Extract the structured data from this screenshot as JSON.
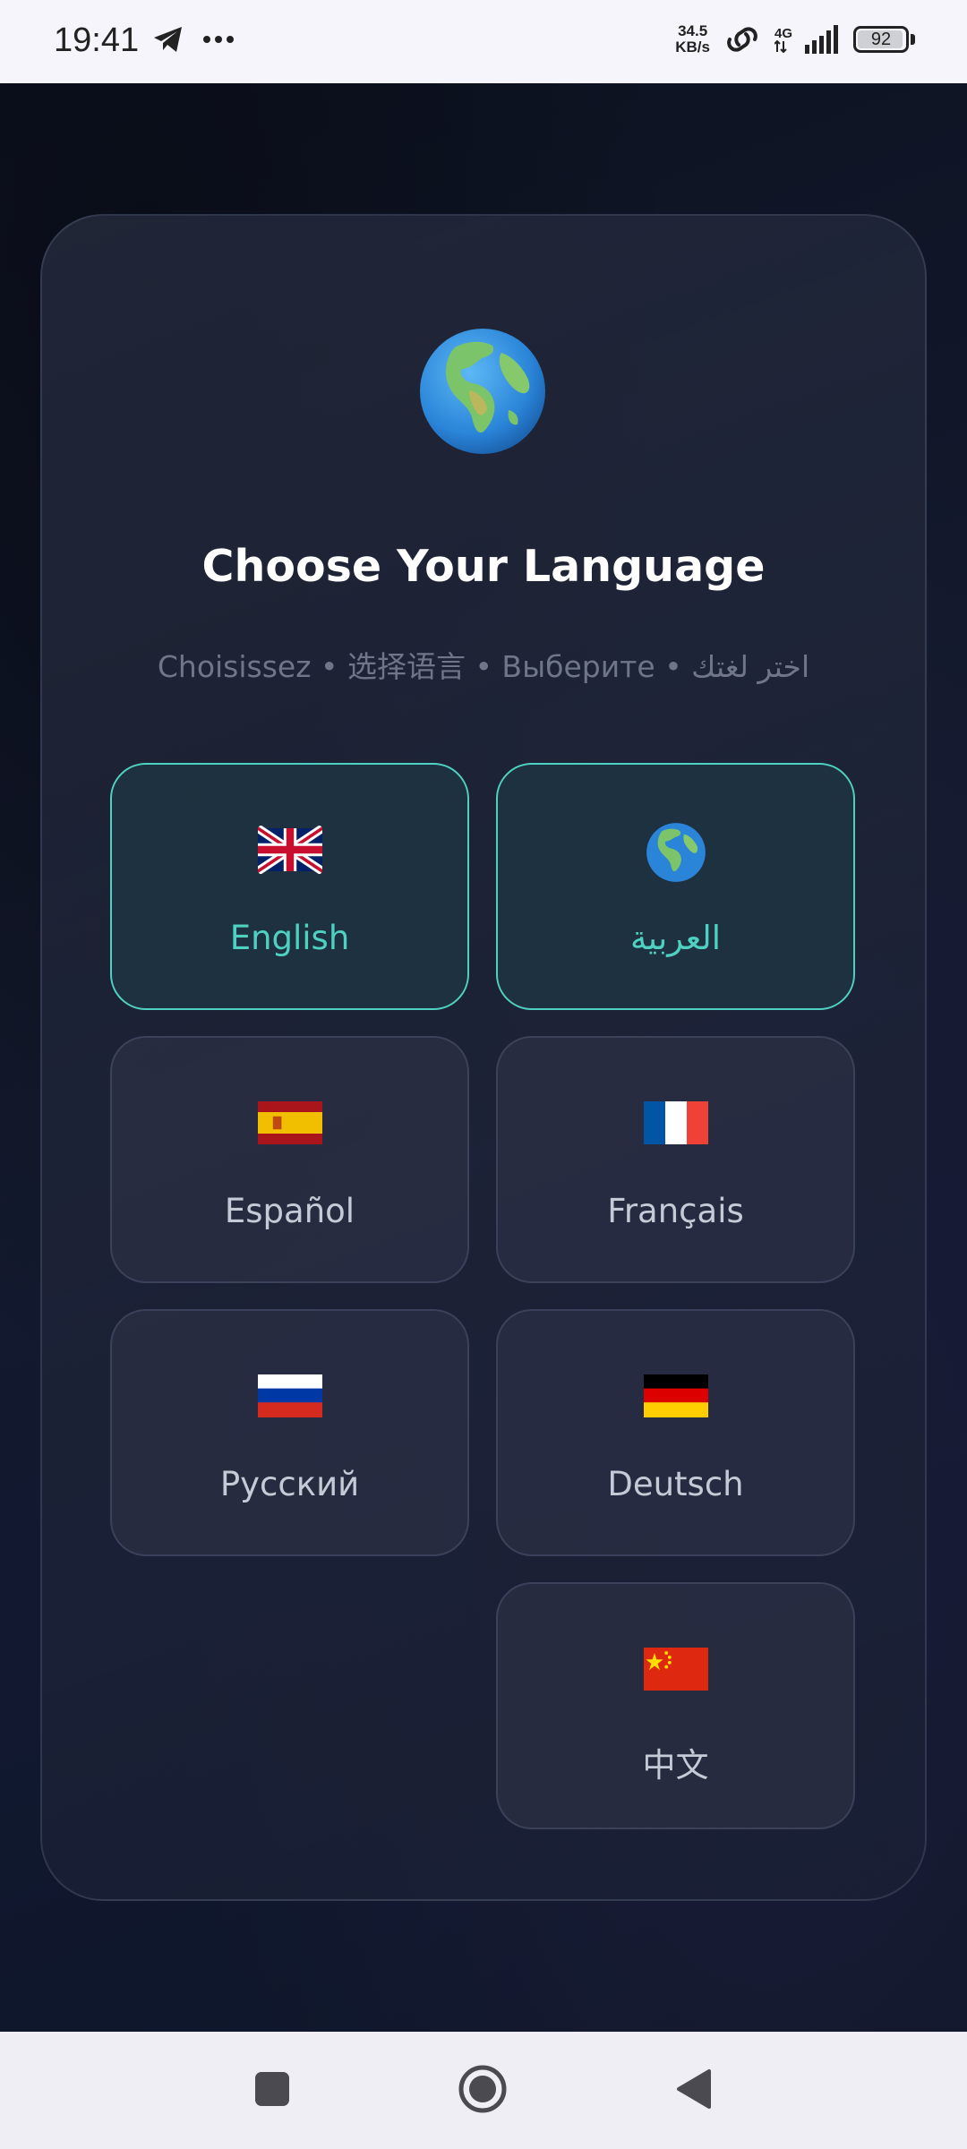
{
  "status_bar": {
    "time": "19:41",
    "net_speed_value": "34.5",
    "net_speed_unit": "KB/s",
    "network_type": "4G",
    "battery_level": "92"
  },
  "screen": {
    "title": "Choose Your Language",
    "subtitle": "Choisissez • 选择语言 • Выберите • اختر لغتك",
    "accent_color": "#4fd1c1"
  },
  "languages": [
    {
      "label": "English",
      "flag": "uk-flag-icon",
      "selected": true
    },
    {
      "label": "العربية",
      "flag": "globe-icon",
      "selected": true
    },
    {
      "label": "Español",
      "flag": "spain-flag-icon",
      "selected": false
    },
    {
      "label": "Français",
      "flag": "france-flag-icon",
      "selected": false
    },
    {
      "label": "Русский",
      "flag": "russia-flag-icon",
      "selected": false
    },
    {
      "label": "Deutsch",
      "flag": "germany-flag-icon",
      "selected": false
    },
    {
      "label": "中文",
      "flag": "china-flag-icon",
      "selected": false
    }
  ],
  "nav_bar": {
    "buttons": [
      "recents-icon",
      "home-icon",
      "back-icon"
    ]
  }
}
